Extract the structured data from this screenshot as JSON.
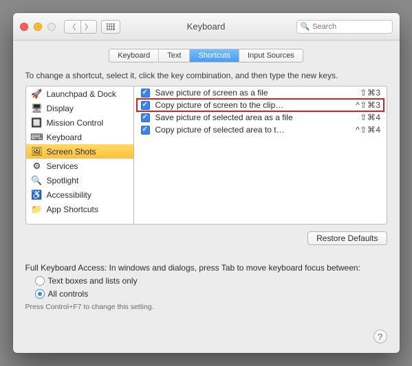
{
  "window": {
    "title": "Keyboard",
    "search_placeholder": "Search"
  },
  "tabs": [
    {
      "label": "Keyboard",
      "active": false
    },
    {
      "label": "Text",
      "active": false
    },
    {
      "label": "Shortcuts",
      "active": true
    },
    {
      "label": "Input Sources",
      "active": false
    }
  ],
  "instruction": "To change a shortcut, select it, click the key combination, and then type the new keys.",
  "sidebar": {
    "items": [
      {
        "label": "Launchpad & Dock",
        "icon": "🚀",
        "selected": false
      },
      {
        "label": "Display",
        "icon": "🖥",
        "selected": false
      },
      {
        "label": "Mission Control",
        "icon": "🔲",
        "selected": false
      },
      {
        "label": "Keyboard",
        "icon": "⌨",
        "selected": false
      },
      {
        "label": "Screen Shots",
        "icon": "🖼",
        "selected": true
      },
      {
        "label": "Services",
        "icon": "⚙",
        "selected": false
      },
      {
        "label": "Spotlight",
        "icon": "🔍",
        "selected": false
      },
      {
        "label": "Accessibility",
        "icon": "♿",
        "selected": false
      },
      {
        "label": "App Shortcuts",
        "icon": "📁",
        "selected": false
      }
    ]
  },
  "shortcuts": [
    {
      "checked": true,
      "label": "Save picture of screen as a file",
      "key": "⇧⌘3",
      "highlighted": false
    },
    {
      "checked": true,
      "label": "Copy picture of screen to the clip…",
      "key": "^⇧⌘3",
      "highlighted": true
    },
    {
      "checked": true,
      "label": "Save picture of selected area as a file",
      "key": "⇧⌘4",
      "highlighted": false
    },
    {
      "checked": true,
      "label": "Copy picture of selected area to t…",
      "key": "^⇧⌘4",
      "highlighted": false
    }
  ],
  "restore_label": "Restore Defaults",
  "fka": {
    "heading": "Full Keyboard Access: In windows and dialogs, press Tab to move keyboard focus between:",
    "opt1": "Text boxes and lists only",
    "opt2": "All controls",
    "selected": 2,
    "hint": "Press Control+F7 to change this setting."
  }
}
